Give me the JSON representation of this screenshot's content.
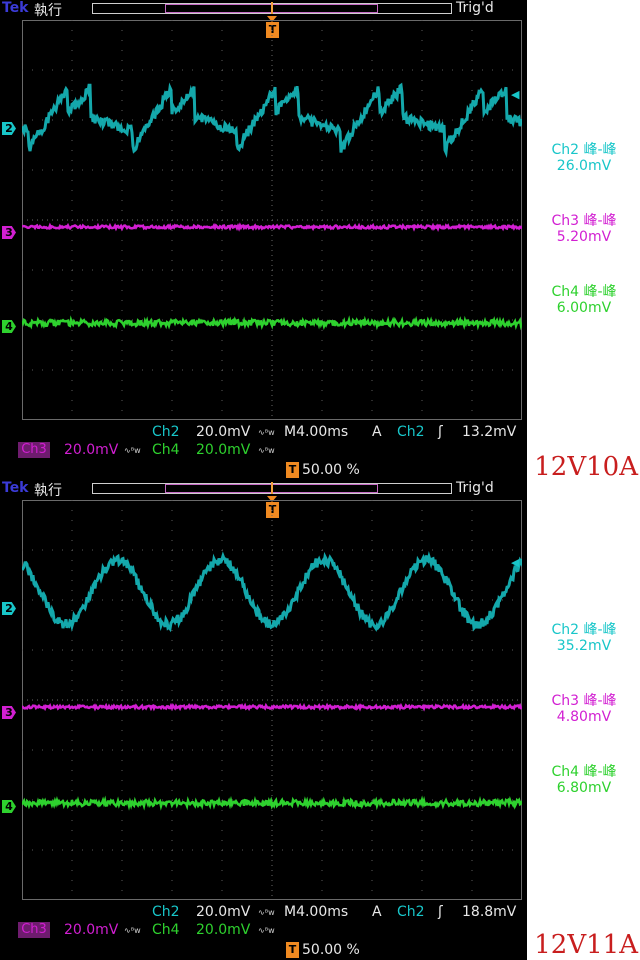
{
  "captures": [
    {
      "header": {
        "brand": "Tek",
        "mode": "執行",
        "trigger_status": "Trig'd"
      },
      "trigger_marker": "T",
      "channel_markers": [
        "2",
        "3",
        "4"
      ],
      "scale_row1": {
        "ch2_label": "Ch2",
        "ch2_scale": "20.0mV",
        "timebase": "M4.00ms",
        "trigger_mode": "A",
        "trigger_source": "Ch2",
        "trigger_edge": "rising-edge-icon",
        "trigger_level": "13.2mV"
      },
      "scale_row2": {
        "ch3_label": "Ch3",
        "ch3_scale": "20.0mV",
        "ch4_label": "Ch4",
        "ch4_scale": "20.0mV"
      },
      "position_percent": "50.00 %",
      "measurements": [
        {
          "label": "Ch2 峰-峰",
          "value": "26.0mV",
          "color": "#18c6c9"
        },
        {
          "label": "Ch3 峰-峰",
          "value": "5.20mV",
          "color": "#d21fd2"
        },
        {
          "label": "Ch4 峰-峰",
          "value": "6.00mV",
          "color": "#2ed12e"
        }
      ],
      "condition_label": "12V10A",
      "waveform_ch2": "sawtooth-ripple"
    },
    {
      "header": {
        "brand": "Tek",
        "mode": "執行",
        "trigger_status": "Trig'd"
      },
      "trigger_marker": "T",
      "channel_markers": [
        "2",
        "3",
        "4"
      ],
      "scale_row1": {
        "ch2_label": "Ch2",
        "ch2_scale": "20.0mV",
        "timebase": "M4.00ms",
        "trigger_mode": "A",
        "trigger_source": "Ch2",
        "trigger_edge": "rising-edge-icon",
        "trigger_level": "18.8mV"
      },
      "scale_row2": {
        "ch3_label": "Ch3",
        "ch3_scale": "20.0mV",
        "ch4_label": "Ch4",
        "ch4_scale": "20.0mV"
      },
      "position_percent": "50.00 %",
      "measurements": [
        {
          "label": "Ch2 峰-峰",
          "value": "35.2mV",
          "color": "#18c6c9"
        },
        {
          "label": "Ch3 峰-峰",
          "value": "4.80mV",
          "color": "#d21fd2"
        },
        {
          "label": "Ch4 峰-峰",
          "value": "6.80mV",
          "color": "#2ed12e"
        }
      ],
      "condition_label": "12V11A",
      "waveform_ch2": "sinusoidal-ripple"
    }
  ],
  "colors": {
    "ch2": "#18c6c9",
    "ch3": "#d21fd2",
    "ch4": "#2ed12e",
    "trigger": "#f08a21",
    "condition_label": "#c81e1e"
  }
}
